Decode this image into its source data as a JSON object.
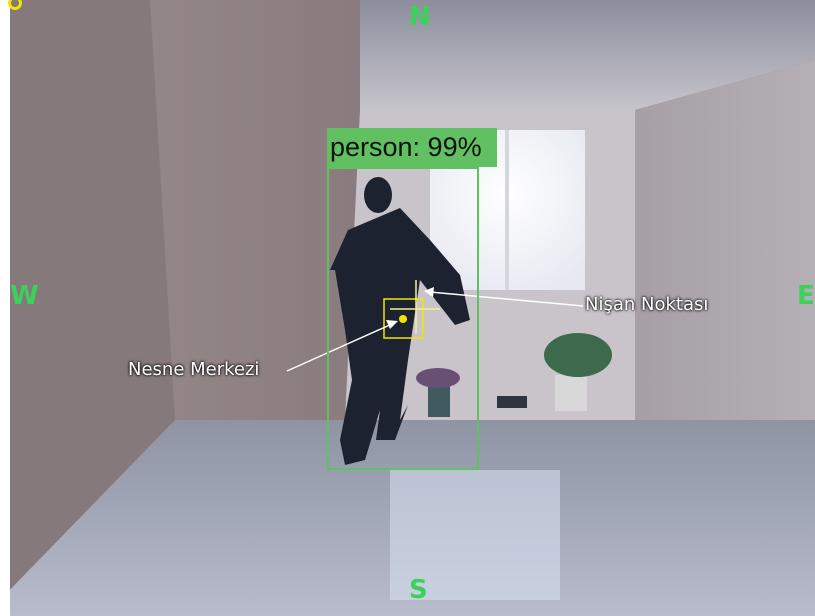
{
  "overlay": {
    "compass": {
      "north": "N",
      "south": "S",
      "west": "W",
      "east": "E"
    },
    "detection": {
      "label": "person: 99%",
      "class": "person",
      "confidence_percent": 99
    },
    "callouts": {
      "aim_point": "Nişan Noktası",
      "object_center": "Nesne Merkezi"
    }
  },
  "colors": {
    "compass": "#3bd15a",
    "detection_box": "#61c062",
    "target_marker": "#f2e400",
    "crosshair": "#f4f28a",
    "callout_text": "#ffffff"
  }
}
